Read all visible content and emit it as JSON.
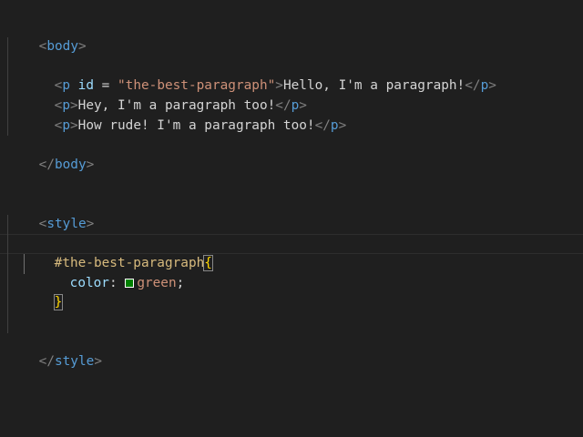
{
  "editor": {
    "colors": {
      "background": "#1f1f1f",
      "tag": "#569cd6",
      "attribute": "#9cdcfe",
      "string": "#ce9178",
      "selector": "#d7ba7d",
      "brace": "#ffd700",
      "swatch": "#008000"
    },
    "lines": {
      "body_open": {
        "lt": "<",
        "tag": "body",
        "gt": ">"
      },
      "p1": {
        "lt": "<",
        "tag": "p",
        "attr": "id",
        "eq": " = ",
        "value": "\"the-best-paragraph\"",
        "gt": ">",
        "text": "Hello, I'm a paragraph!",
        "close_lt": "</",
        "close_tag": "p",
        "close_gt": ">"
      },
      "p2": {
        "lt": "<",
        "tag": "p",
        "gt": ">",
        "text": "Hey, I'm a paragraph too!",
        "close_lt": "</",
        "close_tag": "p",
        "close_gt": ">"
      },
      "p3": {
        "lt": "<",
        "tag": "p",
        "gt": ">",
        "text": "How rude! I'm a paragraph too!",
        "close_lt": "</",
        "close_tag": "p",
        "close_gt": ">"
      },
      "body_close": {
        "lt": "</",
        "tag": "body",
        "gt": ">"
      },
      "style_open": {
        "lt": "<",
        "tag": "style",
        "gt": ">"
      },
      "selector": {
        "name": "#the-best-paragraph",
        "brace": "{"
      },
      "decl": {
        "property": "color",
        "colon": ": ",
        "value": "green",
        "semi": ";"
      },
      "brace_close": {
        "brace": "}"
      },
      "style_close": {
        "lt": "</",
        "tag": "style",
        "gt": ">"
      }
    }
  }
}
